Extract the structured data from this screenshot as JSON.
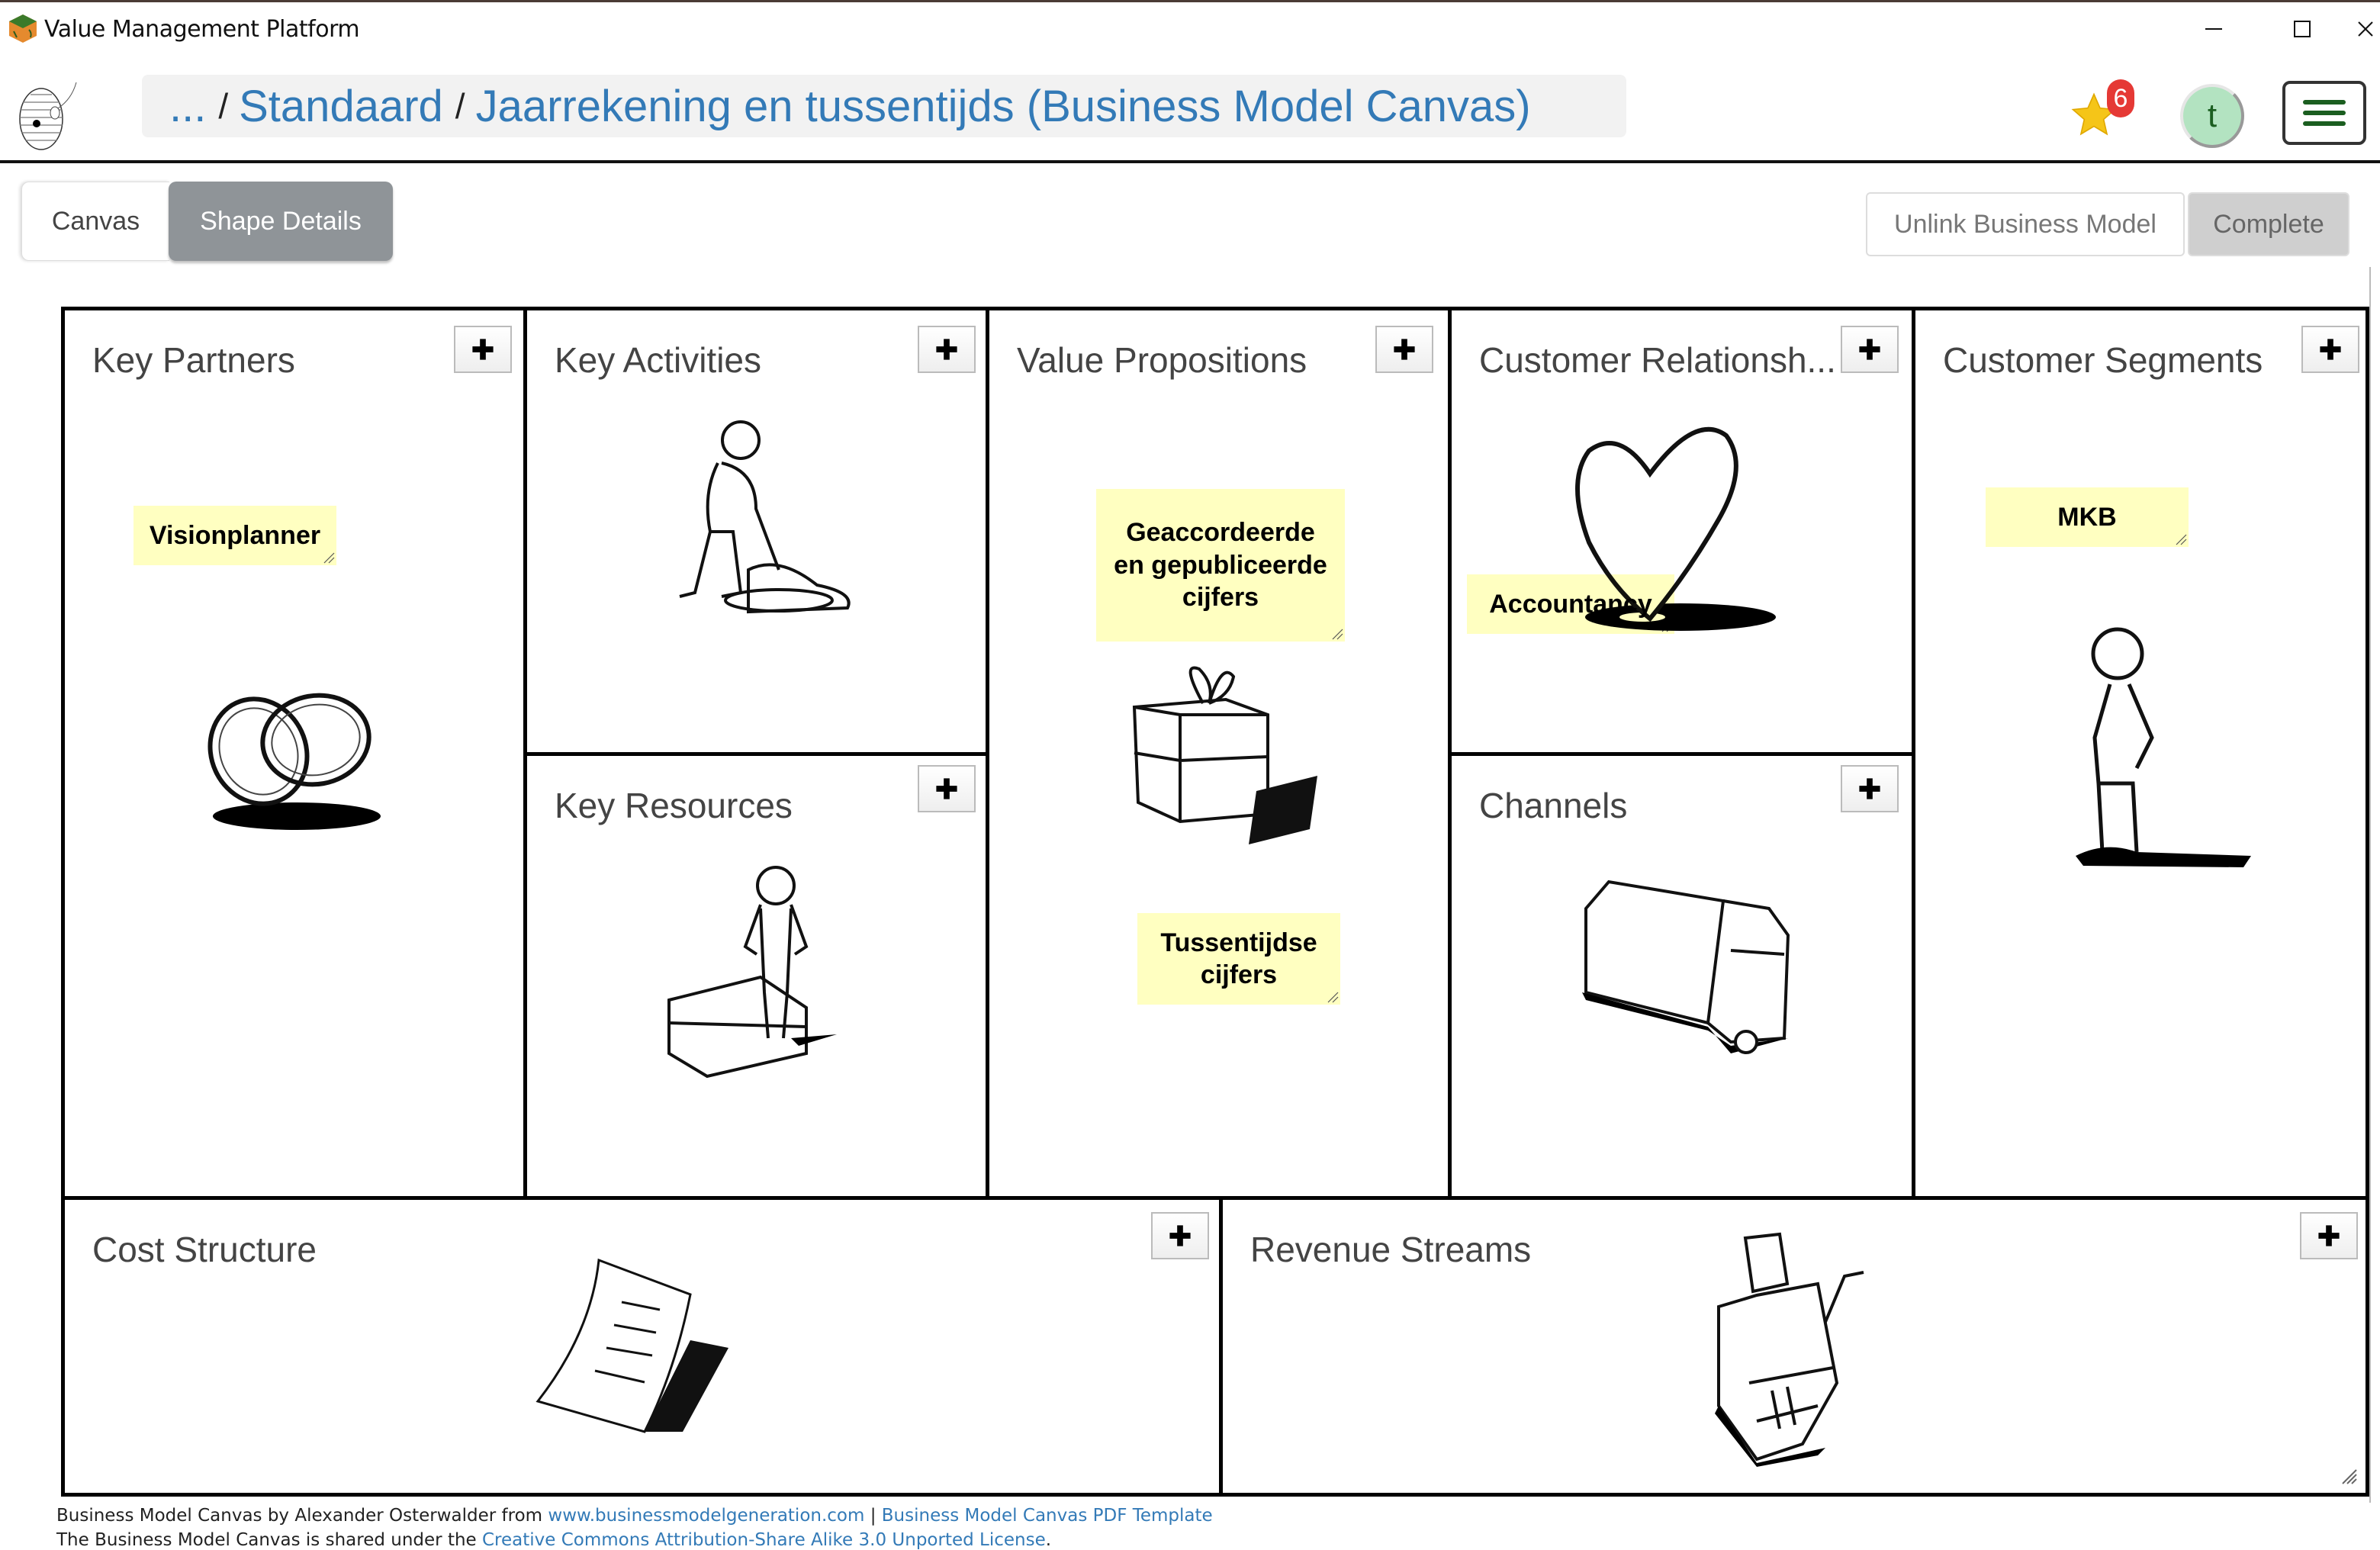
{
  "window": {
    "title": "Value Management Platform",
    "controls": {
      "minimize": "—",
      "maximize": "☐",
      "close": "✕"
    }
  },
  "header": {
    "breadcrumb": {
      "ellipsis": "...",
      "separator": "/",
      "items": [
        "Standaard",
        "Jaarrekening en tussentijds (Business Model Canvas)"
      ]
    },
    "favorites_count": "6",
    "avatar_initial": "t",
    "colors": {
      "link": "#337ab7",
      "badge": "#e53935",
      "star": "#f5c518",
      "avatar_bg": "#b3e3c1",
      "menu": "#1b5e20"
    }
  },
  "tabs": [
    {
      "label": "Canvas",
      "active": true
    },
    {
      "label": "Shape Details",
      "active": false
    }
  ],
  "actions": {
    "unlink_label": "Unlink Business Model",
    "complete_label": "Complete"
  },
  "canvas": {
    "blocks": {
      "key_partners": {
        "title": "Key Partners",
        "illustration": "rings-icon",
        "notes": [
          "Visionplanner"
        ]
      },
      "key_activities": {
        "title": "Key Activities",
        "illustration": "worker-digging-icon",
        "notes": []
      },
      "key_resources": {
        "title": "Key Resources",
        "illustration": "person-with-bed-icon",
        "notes": []
      },
      "value_propositions": {
        "title": "Value Propositions",
        "illustration": "gift-box-icon",
        "notes": [
          "Geaccordeerde en gepubliceerde cijfers",
          "Tussentijdse cijfers"
        ]
      },
      "customer_relationships": {
        "title": "Customer Relationsh...",
        "illustration": "heart-icon",
        "notes": [
          "Accountancy"
        ]
      },
      "channels": {
        "title": "Channels",
        "illustration": "truck-icon",
        "notes": []
      },
      "customer_segments": {
        "title": "Customer Segments",
        "illustration": "standing-person-icon",
        "notes": [
          "MKB"
        ]
      },
      "cost_structure": {
        "title": "Cost Structure",
        "illustration": "bill-document-icon",
        "notes": []
      },
      "revenue_streams": {
        "title": "Revenue Streams",
        "illustration": "cash-register-icon",
        "notes": []
      }
    },
    "add_label": "+",
    "sticky_color": "#ffffc0"
  },
  "footer": {
    "line1_prefix": "Business Model Canvas by Alexander Osterwalder from ",
    "line1_link1": "www.businessmodelgeneration.com",
    "line1_sep": " | ",
    "line1_link2": "Business Model Canvas PDF Template",
    "line2_prefix": "The Business Model Canvas is shared under the ",
    "line2_link": "Creative Commons Attribution-Share Alike 3.0 Unported License",
    "line2_suffix": "."
  }
}
